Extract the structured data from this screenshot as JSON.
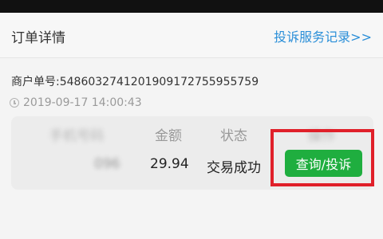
{
  "header": {
    "title": "订单详情",
    "complaint_link": "投诉服务记录>>"
  },
  "order": {
    "merchant_label": "商户单号:",
    "merchant_number": "5486032741201909172755955759",
    "time": "2019-09-17 14:00:43"
  },
  "table": {
    "headers": {
      "phone": "手机号码",
      "amount": "金额",
      "status": "状态",
      "action": "操作"
    },
    "row": {
      "phone": "096",
      "amount": "29.94",
      "status": "交易成功",
      "action_label": "查询/投诉"
    }
  },
  "colors": {
    "link": "#2b8fd8",
    "button": "#1fae3f",
    "highlight": "#e0202a"
  }
}
